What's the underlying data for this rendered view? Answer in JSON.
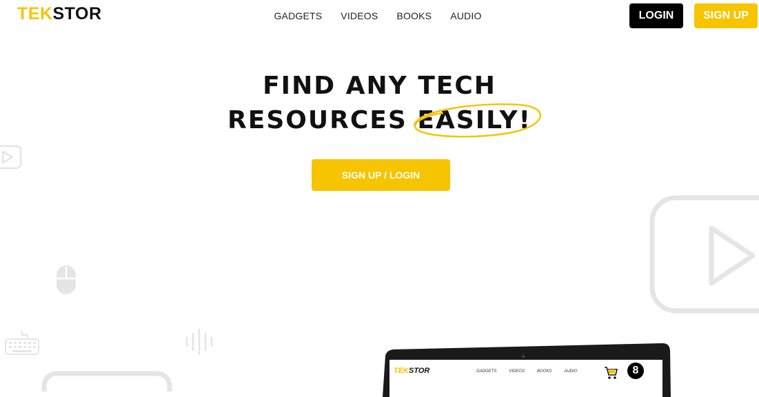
{
  "logo": {
    "part1": "TEK",
    "part2": "STOR"
  },
  "nav": {
    "items": [
      "GADGETS",
      "VIDEOS",
      "BOOKS",
      "AUDIO"
    ]
  },
  "header_buttons": {
    "login": "LOGIN",
    "signup": "SIGN UP"
  },
  "hero": {
    "line1": "FIND ANY TECH",
    "line2_prefix": "RESOURCES",
    "line2_highlight": "EASILY!",
    "cta": "SIGN UP / LOGIN"
  },
  "mockup": {
    "logo_part1": "TEK",
    "logo_part2": "STOR",
    "nav": [
      "GADGETS",
      "VIDEOS",
      "BOOKS",
      "AUDIO"
    ],
    "badge": "8"
  },
  "colors": {
    "accent": "#f7c400",
    "dark": "#000000",
    "deco": "#e5e5e5"
  },
  "icons": [
    "play-icon",
    "mouse-icon",
    "keyboard-icon",
    "sound-wave-icon",
    "cart-icon"
  ]
}
